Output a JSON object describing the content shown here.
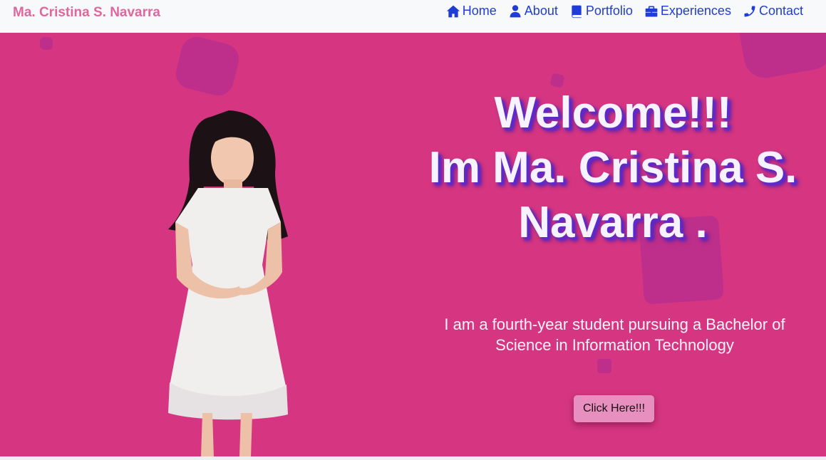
{
  "brand": "Ma. Cristina S. Navarra",
  "nav": [
    {
      "label": "Home",
      "icon": "home-icon"
    },
    {
      "label": "About",
      "icon": "user-icon"
    },
    {
      "label": "Portfolio",
      "icon": "book-icon"
    },
    {
      "label": "Experiences",
      "icon": "briefcase-icon"
    },
    {
      "label": "Contact",
      "icon": "phone-icon"
    }
  ],
  "hero": {
    "line1": "Welcome!!!",
    "line2": "Im Ma. Cristina S.",
    "line3": "Navarra .",
    "subtext": "I am a fourth-year student pursuing a Bachelor of Science in Information Technology",
    "cta_label": "Click Here!!!"
  },
  "colors": {
    "hero_bg": "#d63681",
    "brand": "#e0679e",
    "nav_link": "#1f3dd6",
    "headline_shadow": "#5a2bd0"
  }
}
